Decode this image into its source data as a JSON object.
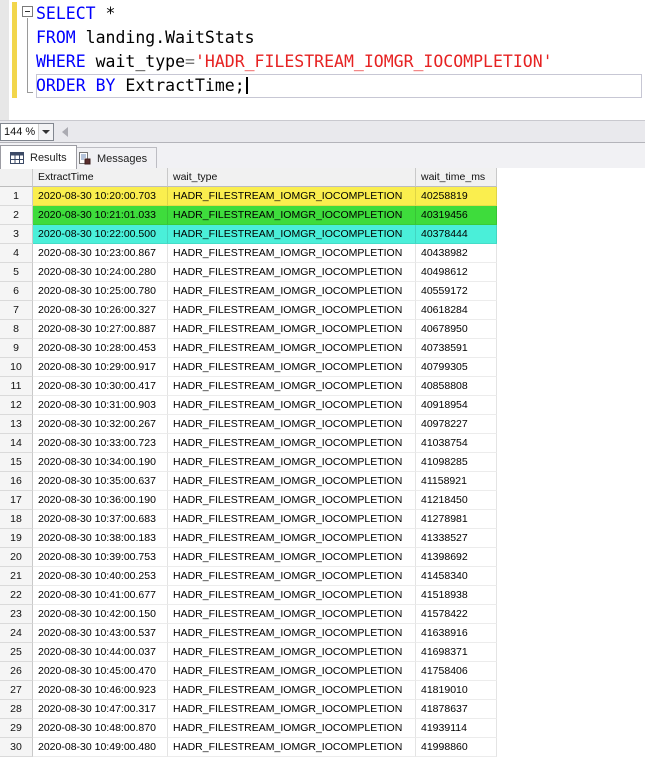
{
  "editor": {
    "language": "sql",
    "lines": [
      {
        "tokens": [
          [
            "keyword",
            "SELECT"
          ],
          [
            "plain",
            " *"
          ]
        ],
        "fold_start": true
      },
      {
        "tokens": [
          [
            "keyword",
            "FROM"
          ],
          [
            "plain",
            " landing.WaitStats"
          ]
        ]
      },
      {
        "tokens": [
          [
            "keyword",
            "WHERE"
          ],
          [
            "plain",
            " wait_type"
          ],
          [
            "operator",
            "="
          ],
          [
            "string",
            "'HADR_FILESTREAM_IOMGR_IOCOMPLETION'"
          ]
        ]
      },
      {
        "tokens": [
          [
            "keyword",
            "ORDER BY"
          ],
          [
            "plain",
            " ExtractTime;"
          ]
        ],
        "caret": true,
        "current": true
      }
    ],
    "syntax_colors": {
      "keyword": "#0000FF",
      "string": "#E62222",
      "operator": "#777777",
      "plain": "#000000"
    },
    "change_bar_color": "#F2D64B"
  },
  "statusbar": {
    "zoom_value": "144 %"
  },
  "tabs": [
    {
      "label": "Results",
      "icon": "results-grid-icon",
      "active": true
    },
    {
      "label": "Messages",
      "icon": "messages-icon",
      "active": false
    }
  ],
  "grid": {
    "columns": [
      "ExtractTime",
      "wait_type",
      "wait_time_ms"
    ],
    "highlight_colors": {
      "yellow": "#FAEE4E",
      "green": "#3EDC3C",
      "turquoise": "#4AEFD9"
    },
    "rows": [
      {
        "n": "1",
        "extract_time": "2020-08-30 10:20:00.703",
        "wait_type": "HADR_FILESTREAM_IOMGR_IOCOMPLETION",
        "wait_time_ms": "40258819",
        "highlight": "yellow"
      },
      {
        "n": "2",
        "extract_time": "2020-08-30 10:21:01.033",
        "wait_type": "HADR_FILESTREAM_IOMGR_IOCOMPLETION",
        "wait_time_ms": "40319456",
        "highlight": "green"
      },
      {
        "n": "3",
        "extract_time": "2020-08-30 10:22:00.500",
        "wait_type": "HADR_FILESTREAM_IOMGR_IOCOMPLETION",
        "wait_time_ms": "40378444",
        "highlight": "turquoise"
      },
      {
        "n": "4",
        "extract_time": "2020-08-30 10:23:00.867",
        "wait_type": "HADR_FILESTREAM_IOMGR_IOCOMPLETION",
        "wait_time_ms": "40438982",
        "highlight": null
      },
      {
        "n": "5",
        "extract_time": "2020-08-30 10:24:00.280",
        "wait_type": "HADR_FILESTREAM_IOMGR_IOCOMPLETION",
        "wait_time_ms": "40498612",
        "highlight": null
      },
      {
        "n": "6",
        "extract_time": "2020-08-30 10:25:00.780",
        "wait_type": "HADR_FILESTREAM_IOMGR_IOCOMPLETION",
        "wait_time_ms": "40559172",
        "highlight": null
      },
      {
        "n": "7",
        "extract_time": "2020-08-30 10:26:00.327",
        "wait_type": "HADR_FILESTREAM_IOMGR_IOCOMPLETION",
        "wait_time_ms": "40618284",
        "highlight": null
      },
      {
        "n": "8",
        "extract_time": "2020-08-30 10:27:00.887",
        "wait_type": "HADR_FILESTREAM_IOMGR_IOCOMPLETION",
        "wait_time_ms": "40678950",
        "highlight": null
      },
      {
        "n": "9",
        "extract_time": "2020-08-30 10:28:00.453",
        "wait_type": "HADR_FILESTREAM_IOMGR_IOCOMPLETION",
        "wait_time_ms": "40738591",
        "highlight": null
      },
      {
        "n": "10",
        "extract_time": "2020-08-30 10:29:00.917",
        "wait_type": "HADR_FILESTREAM_IOMGR_IOCOMPLETION",
        "wait_time_ms": "40799305",
        "highlight": null
      },
      {
        "n": "11",
        "extract_time": "2020-08-30 10:30:00.417",
        "wait_type": "HADR_FILESTREAM_IOMGR_IOCOMPLETION",
        "wait_time_ms": "40858808",
        "highlight": null
      },
      {
        "n": "12",
        "extract_time": "2020-08-30 10:31:00.903",
        "wait_type": "HADR_FILESTREAM_IOMGR_IOCOMPLETION",
        "wait_time_ms": "40918954",
        "highlight": null
      },
      {
        "n": "13",
        "extract_time": "2020-08-30 10:32:00.267",
        "wait_type": "HADR_FILESTREAM_IOMGR_IOCOMPLETION",
        "wait_time_ms": "40978227",
        "highlight": null
      },
      {
        "n": "14",
        "extract_time": "2020-08-30 10:33:00.723",
        "wait_type": "HADR_FILESTREAM_IOMGR_IOCOMPLETION",
        "wait_time_ms": "41038754",
        "highlight": null
      },
      {
        "n": "15",
        "extract_time": "2020-08-30 10:34:00.190",
        "wait_type": "HADR_FILESTREAM_IOMGR_IOCOMPLETION",
        "wait_time_ms": "41098285",
        "highlight": null
      },
      {
        "n": "16",
        "extract_time": "2020-08-30 10:35:00.637",
        "wait_type": "HADR_FILESTREAM_IOMGR_IOCOMPLETION",
        "wait_time_ms": "41158921",
        "highlight": null
      },
      {
        "n": "17",
        "extract_time": "2020-08-30 10:36:00.190",
        "wait_type": "HADR_FILESTREAM_IOMGR_IOCOMPLETION",
        "wait_time_ms": "41218450",
        "highlight": null
      },
      {
        "n": "18",
        "extract_time": "2020-08-30 10:37:00.683",
        "wait_type": "HADR_FILESTREAM_IOMGR_IOCOMPLETION",
        "wait_time_ms": "41278981",
        "highlight": null
      },
      {
        "n": "19",
        "extract_time": "2020-08-30 10:38:00.183",
        "wait_type": "HADR_FILESTREAM_IOMGR_IOCOMPLETION",
        "wait_time_ms": "41338527",
        "highlight": null
      },
      {
        "n": "20",
        "extract_time": "2020-08-30 10:39:00.753",
        "wait_type": "HADR_FILESTREAM_IOMGR_IOCOMPLETION",
        "wait_time_ms": "41398692",
        "highlight": null
      },
      {
        "n": "21",
        "extract_time": "2020-08-30 10:40:00.253",
        "wait_type": "HADR_FILESTREAM_IOMGR_IOCOMPLETION",
        "wait_time_ms": "41458340",
        "highlight": null
      },
      {
        "n": "22",
        "extract_time": "2020-08-30 10:41:00.677",
        "wait_type": "HADR_FILESTREAM_IOMGR_IOCOMPLETION",
        "wait_time_ms": "41518938",
        "highlight": null
      },
      {
        "n": "23",
        "extract_time": "2020-08-30 10:42:00.150",
        "wait_type": "HADR_FILESTREAM_IOMGR_IOCOMPLETION",
        "wait_time_ms": "41578422",
        "highlight": null
      },
      {
        "n": "24",
        "extract_time": "2020-08-30 10:43:00.537",
        "wait_type": "HADR_FILESTREAM_IOMGR_IOCOMPLETION",
        "wait_time_ms": "41638916",
        "highlight": null
      },
      {
        "n": "25",
        "extract_time": "2020-08-30 10:44:00.037",
        "wait_type": "HADR_FILESTREAM_IOMGR_IOCOMPLETION",
        "wait_time_ms": "41698371",
        "highlight": null
      },
      {
        "n": "26",
        "extract_time": "2020-08-30 10:45:00.470",
        "wait_type": "HADR_FILESTREAM_IOMGR_IOCOMPLETION",
        "wait_time_ms": "41758406",
        "highlight": null
      },
      {
        "n": "27",
        "extract_time": "2020-08-30 10:46:00.923",
        "wait_type": "HADR_FILESTREAM_IOMGR_IOCOMPLETION",
        "wait_time_ms": "41819010",
        "highlight": null
      },
      {
        "n": "28",
        "extract_time": "2020-08-30 10:47:00.317",
        "wait_type": "HADR_FILESTREAM_IOMGR_IOCOMPLETION",
        "wait_time_ms": "41878637",
        "highlight": null
      },
      {
        "n": "29",
        "extract_time": "2020-08-30 10:48:00.870",
        "wait_type": "HADR_FILESTREAM_IOMGR_IOCOMPLETION",
        "wait_time_ms": "41939114",
        "highlight": null
      },
      {
        "n": "30",
        "extract_time": "2020-08-30 10:49:00.480",
        "wait_type": "HADR_FILESTREAM_IOMGR_IOCOMPLETION",
        "wait_time_ms": "41998860",
        "highlight": null
      }
    ]
  }
}
